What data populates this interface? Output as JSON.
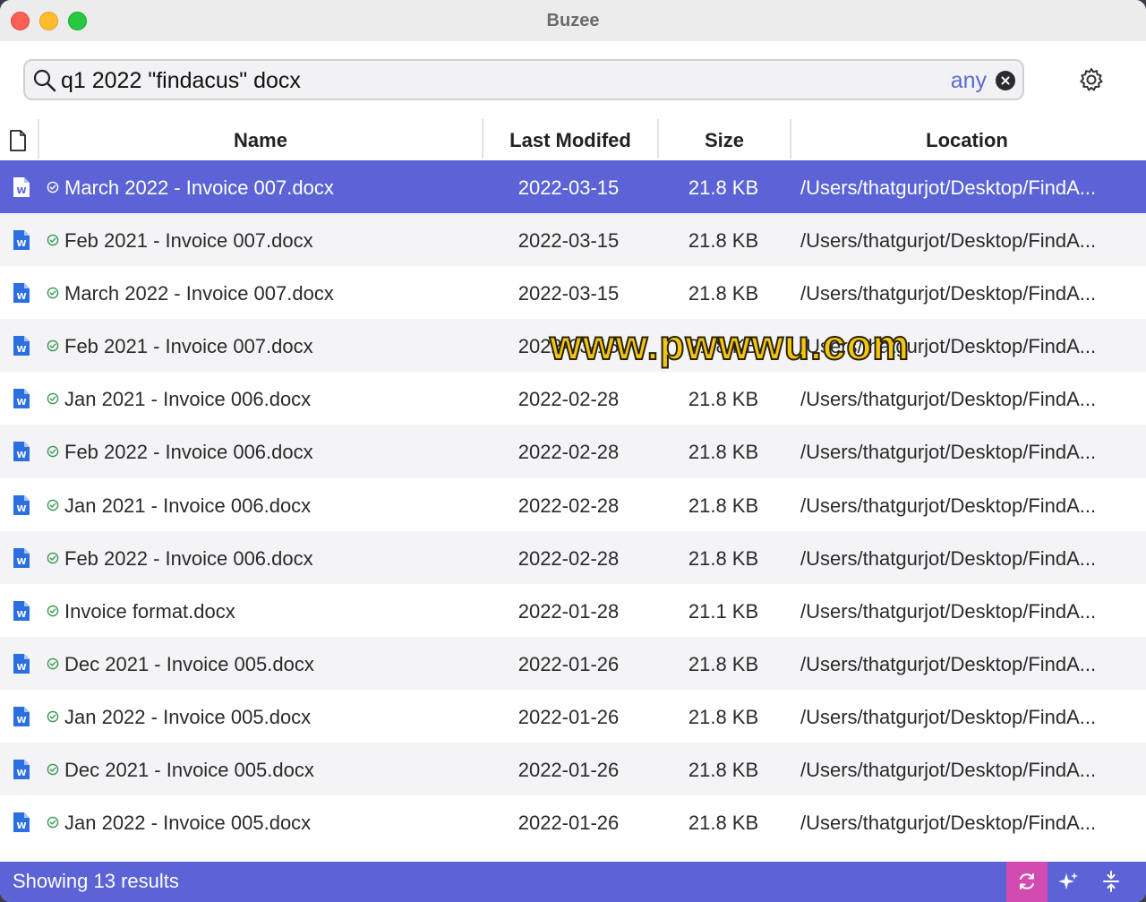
{
  "window": {
    "title": "Buzee"
  },
  "search": {
    "query": "q1 2022 \"findacus\" docx",
    "match_mode": "any"
  },
  "table": {
    "columns": {
      "name": "Name",
      "modified": "Last Modifed",
      "size": "Size",
      "location": "Location"
    },
    "rows": [
      {
        "name": "March 2022 - Invoice 007.docx",
        "modified": "2022-03-15",
        "size": "21.8 KB",
        "location": "/Users/thatgurjot/Desktop/FindA...",
        "selected": true
      },
      {
        "name": "Feb 2021 - Invoice 007.docx",
        "modified": "2022-03-15",
        "size": "21.8 KB",
        "location": "/Users/thatgurjot/Desktop/FindA..."
      },
      {
        "name": "March 2022 - Invoice 007.docx",
        "modified": "2022-03-15",
        "size": "21.8 KB",
        "location": "/Users/thatgurjot/Desktop/FindA..."
      },
      {
        "name": "Feb 2021 - Invoice 007.docx",
        "modified": "2022-03-15",
        "size": "21.8 KB",
        "location": "/Users/thatgurjot/Desktop/FindA..."
      },
      {
        "name": "Jan 2021 - Invoice 006.docx",
        "modified": "2022-02-28",
        "size": "21.8 KB",
        "location": "/Users/thatgurjot/Desktop/FindA..."
      },
      {
        "name": "Feb 2022 - Invoice 006.docx",
        "modified": "2022-02-28",
        "size": "21.8 KB",
        "location": "/Users/thatgurjot/Desktop/FindA..."
      },
      {
        "name": "Jan 2021 - Invoice 006.docx",
        "modified": "2022-02-28",
        "size": "21.8 KB",
        "location": "/Users/thatgurjot/Desktop/FindA..."
      },
      {
        "name": "Feb 2022 - Invoice 006.docx",
        "modified": "2022-02-28",
        "size": "21.8 KB",
        "location": "/Users/thatgurjot/Desktop/FindA..."
      },
      {
        "name": "Invoice format.docx",
        "modified": "2022-01-28",
        "size": "21.1 KB",
        "location": "/Users/thatgurjot/Desktop/FindA..."
      },
      {
        "name": "Dec 2021 - Invoice 005.docx",
        "modified": "2022-01-26",
        "size": "21.8 KB",
        "location": "/Users/thatgurjot/Desktop/FindA..."
      },
      {
        "name": "Jan 2022 - Invoice 005.docx",
        "modified": "2022-01-26",
        "size": "21.8 KB",
        "location": "/Users/thatgurjot/Desktop/FindA..."
      },
      {
        "name": "Dec 2021 - Invoice 005.docx",
        "modified": "2022-01-26",
        "size": "21.8 KB",
        "location": "/Users/thatgurjot/Desktop/FindA..."
      },
      {
        "name": "Jan 2022 - Invoice 005.docx",
        "modified": "2022-01-26",
        "size": "21.8 KB",
        "location": "/Users/thatgurjot/Desktop/FindA..."
      }
    ]
  },
  "status": {
    "results_text": "Showing 13 results"
  },
  "watermark": {
    "text": "www.pwwwu.com"
  },
  "colors": {
    "accent": "#5b63d6",
    "refresh_active": "#d24bb0",
    "match_mode": "#5a6bd0"
  },
  "icons": {
    "search": "search-icon",
    "clear": "clear-icon",
    "settings": "gear-icon",
    "file": "word-document-icon",
    "status": "check-circle-icon",
    "refresh": "refresh-icon",
    "sparkle": "sparkle-icon",
    "collapse": "collapse-icon"
  }
}
